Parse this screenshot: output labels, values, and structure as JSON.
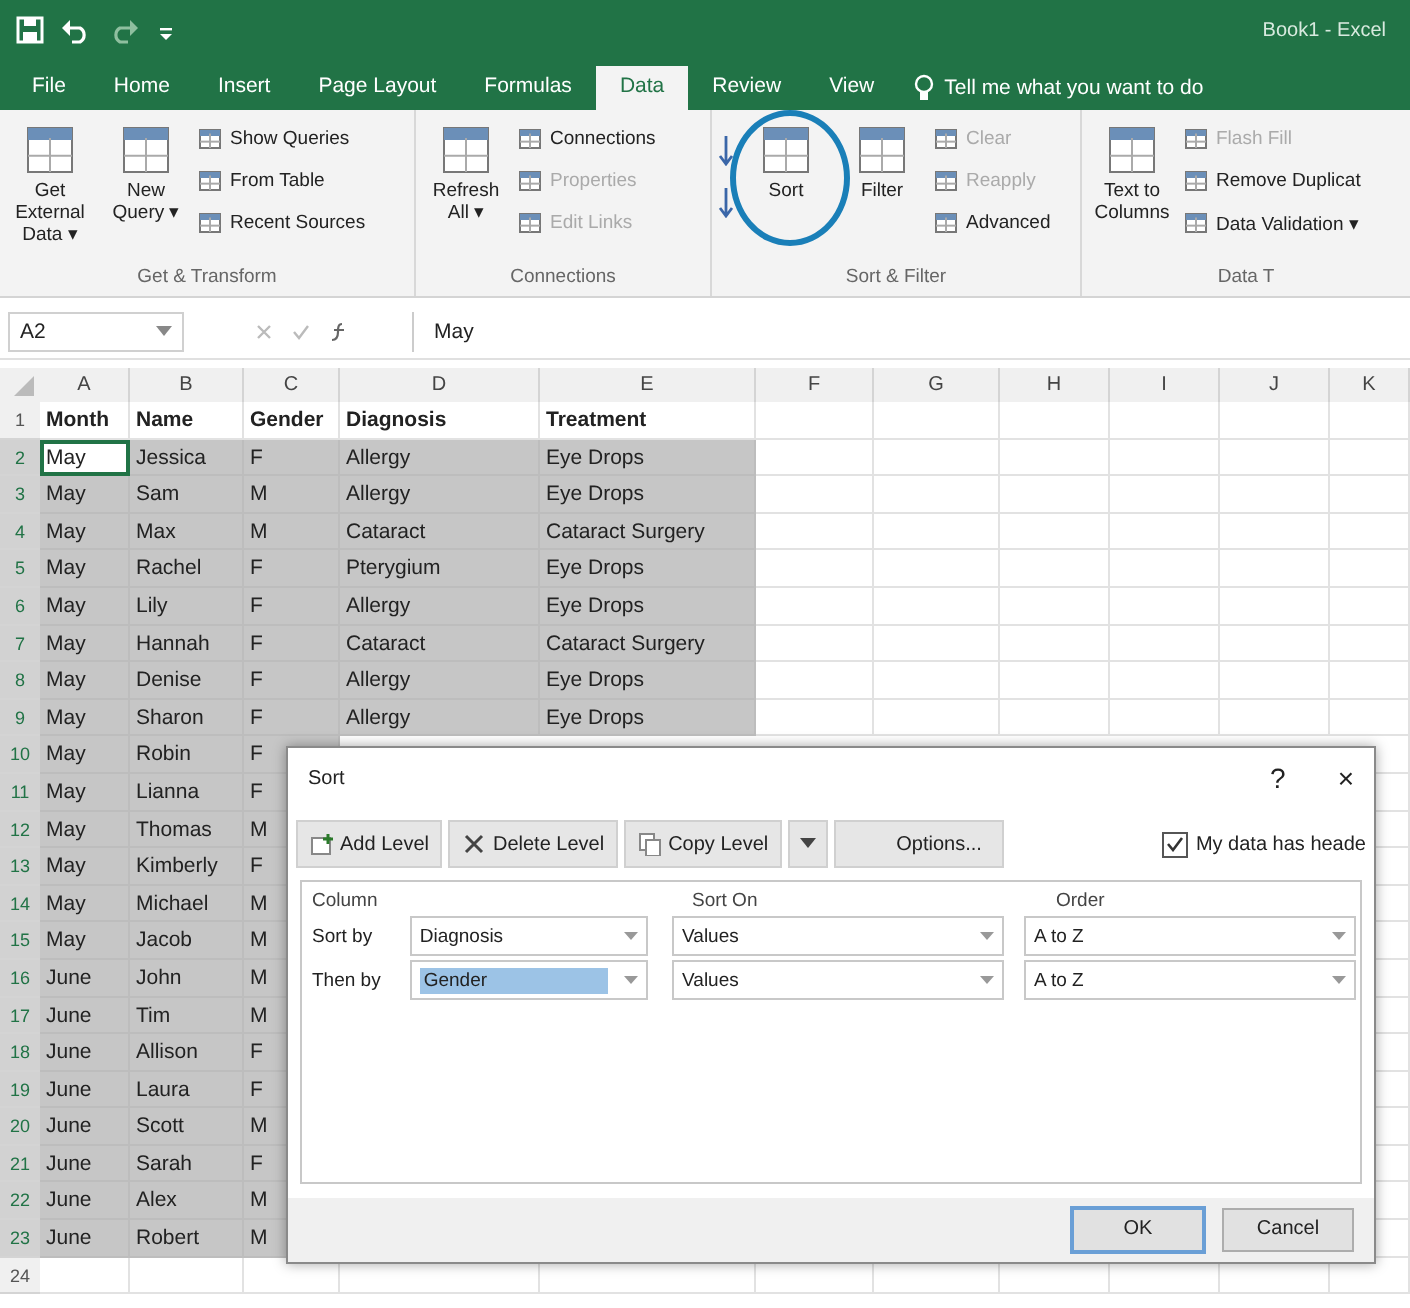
{
  "title_bar": {
    "title": "Book1 - Excel"
  },
  "ribbon_tabs": [
    {
      "label": "File",
      "selected": false
    },
    {
      "label": "Home",
      "selected": false
    },
    {
      "label": "Insert",
      "selected": false
    },
    {
      "label": "Page Layout",
      "selected": false
    },
    {
      "label": "Formulas",
      "selected": false
    },
    {
      "label": "Data",
      "selected": true
    },
    {
      "label": "Review",
      "selected": false
    },
    {
      "label": "View",
      "selected": false
    }
  ],
  "tell_me": "Tell me what you want to do",
  "ribbon_groups": [
    {
      "label": "Get & Transform",
      "items": [
        {
          "kind": "large",
          "label": "Get External Data ▾",
          "disabled": false
        },
        {
          "kind": "large",
          "label": "New Query ▾",
          "disabled": false
        },
        {
          "kind": "stack",
          "items": [
            {
              "label": "Show Queries",
              "disabled": false
            },
            {
              "label": "From Table",
              "disabled": false
            },
            {
              "label": "Recent Sources",
              "disabled": false
            }
          ]
        }
      ]
    },
    {
      "label": "Connections",
      "items": [
        {
          "kind": "large",
          "label": "Refresh All ▾",
          "disabled": false
        },
        {
          "kind": "stack",
          "items": [
            {
              "label": "Connections",
              "disabled": false
            },
            {
              "label": "Properties",
              "disabled": true
            },
            {
              "label": "Edit Links",
              "disabled": true
            }
          ]
        }
      ]
    },
    {
      "label": "Sort & Filter",
      "items": [
        {
          "kind": "sort_pair"
        },
        {
          "kind": "large",
          "label": "Sort",
          "disabled": false,
          "highlighted": true
        },
        {
          "kind": "large",
          "label": "Filter",
          "disabled": false
        },
        {
          "kind": "stack",
          "items": [
            {
              "label": "Clear",
              "disabled": true
            },
            {
              "label": "Reapply",
              "disabled": true
            },
            {
              "label": "Advanced",
              "disabled": false
            }
          ]
        }
      ]
    },
    {
      "label": "Data T",
      "items": [
        {
          "kind": "large",
          "label": "Text to Columns",
          "disabled": false
        },
        {
          "kind": "stack",
          "items": [
            {
              "label": "Flash Fill",
              "disabled": true
            },
            {
              "label": "Remove Duplicat",
              "disabled": false
            },
            {
              "label": "Data Validation ▾",
              "disabled": false
            }
          ]
        }
      ]
    }
  ],
  "formula_bar": {
    "name_box": "A2",
    "formula": "May"
  },
  "columns": [
    "A",
    "B",
    "C",
    "D",
    "E",
    "F",
    "G",
    "H",
    "I",
    "J",
    "K"
  ],
  "rows": [
    {
      "number": "1",
      "selected": false,
      "cells": [
        "Month",
        "Name",
        "Gender",
        "Diagnosis",
        "Treatment"
      ]
    },
    {
      "number": "2",
      "selected": true,
      "cells": [
        "May",
        "Jessica",
        "F",
        "Allergy",
        "Eye Drops"
      ]
    },
    {
      "number": "3",
      "selected": true,
      "cells": [
        "May",
        "Sam",
        "M",
        "Allergy",
        "Eye Drops"
      ]
    },
    {
      "number": "4",
      "selected": true,
      "cells": [
        "May",
        "Max",
        "M",
        "Cataract",
        "Cataract Surgery"
      ]
    },
    {
      "number": "5",
      "selected": true,
      "cells": [
        "May",
        "Rachel",
        "F",
        "Pterygium",
        "Eye Drops"
      ]
    },
    {
      "number": "6",
      "selected": true,
      "cells": [
        "May",
        "Lily",
        "F",
        "Allergy",
        "Eye Drops"
      ]
    },
    {
      "number": "7",
      "selected": true,
      "cells": [
        "May",
        "Hannah",
        "F",
        "Cataract",
        "Cataract Surgery"
      ]
    },
    {
      "number": "8",
      "selected": true,
      "cells": [
        "May",
        "Denise",
        "F",
        "Allergy",
        "Eye Drops"
      ]
    },
    {
      "number": "9",
      "selected": true,
      "cells": [
        "May",
        "Sharon",
        "F",
        "Allergy",
        "Eye Drops"
      ]
    },
    {
      "number": "10",
      "selected": true,
      "cells": [
        "May",
        "Robin",
        "F"
      ]
    },
    {
      "number": "11",
      "selected": true,
      "cells": [
        "May",
        "Lianna",
        "F"
      ]
    },
    {
      "number": "12",
      "selected": true,
      "cells": [
        "May",
        "Thomas",
        "M"
      ]
    },
    {
      "number": "13",
      "selected": true,
      "cells": [
        "May",
        "Kimberly",
        "F"
      ]
    },
    {
      "number": "14",
      "selected": true,
      "cells": [
        "May",
        "Michael",
        "M"
      ]
    },
    {
      "number": "15",
      "selected": true,
      "cells": [
        "May",
        "Jacob",
        "M"
      ]
    },
    {
      "number": "16",
      "selected": true,
      "cells": [
        "June",
        "John",
        "M"
      ]
    },
    {
      "number": "17",
      "selected": true,
      "cells": [
        "June",
        "Tim",
        "M"
      ]
    },
    {
      "number": "18",
      "selected": true,
      "cells": [
        "June",
        "Allison",
        "F"
      ]
    },
    {
      "number": "19",
      "selected": true,
      "cells": [
        "June",
        "Laura",
        "F"
      ]
    },
    {
      "number": "20",
      "selected": true,
      "cells": [
        "June",
        "Scott",
        "M"
      ]
    },
    {
      "number": "21",
      "selected": true,
      "cells": [
        "June",
        "Sarah",
        "F"
      ]
    },
    {
      "number": "22",
      "selected": true,
      "cells": [
        "June",
        "Alex",
        "M"
      ]
    },
    {
      "number": "23",
      "selected": true,
      "cells": [
        "June",
        "Robert",
        "M"
      ]
    },
    {
      "number": "24",
      "selected": false,
      "cells": []
    }
  ],
  "sort_dialog": {
    "title": "Sort",
    "help": "?",
    "close": "×",
    "toolbar": [
      {
        "label": "Add Level"
      },
      {
        "label": "Delete Level"
      },
      {
        "label": "Copy Level"
      },
      {
        "label": "Options..."
      }
    ],
    "headers_checkbox": {
      "label": "My data has heade",
      "checked": true
    },
    "column_headers": [
      "Column",
      "Sort On",
      "Order"
    ],
    "levels": [
      {
        "label": "Sort by",
        "column": "Diagnosis",
        "sort_on": "Values",
        "order": "A to Z",
        "selected": false
      },
      {
        "label": "Then by",
        "column": "Gender",
        "sort_on": "Values",
        "order": "A to Z",
        "selected": true
      }
    ],
    "buttons": [
      "OK",
      "Cancel"
    ]
  }
}
